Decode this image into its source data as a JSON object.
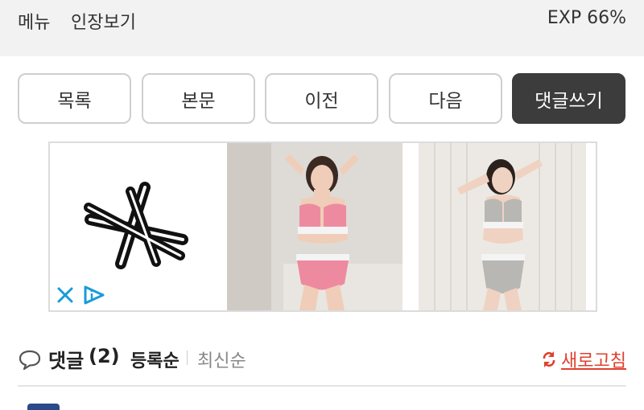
{
  "topbar": {
    "menu": "메뉴",
    "view_mode": "인장보기",
    "exp": "EXP 66%"
  },
  "nav": {
    "list": "목록",
    "body": "본문",
    "prev": "이전",
    "next": "다음",
    "write_comment": "댓글쓰기"
  },
  "ad": {
    "images": [
      "model-pink-underwear-photo",
      "model-gray-underwear-photo"
    ],
    "icons": [
      "brand-logo-icon",
      "close-icon",
      "ad-info-icon"
    ]
  },
  "comments": {
    "title": "댓글",
    "count": "(2)",
    "sort_registered": "등록순",
    "sort_latest": "최신순",
    "refresh": "새로고침"
  },
  "colors": {
    "accent": "#e0402f",
    "dark_button": "#3c3c3c",
    "ad_icon": "#1a9bd7"
  }
}
